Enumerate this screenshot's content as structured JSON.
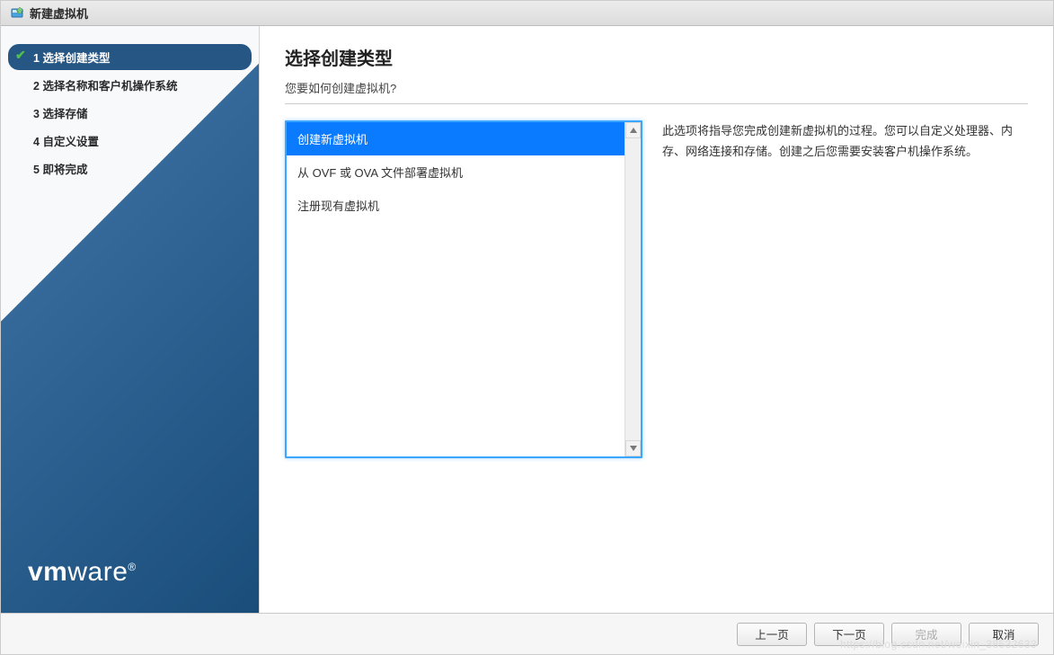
{
  "window": {
    "title": "新建虚拟机"
  },
  "sidebar": {
    "steps": [
      {
        "num": "1",
        "label": "选择创建类型",
        "active": true,
        "check": "✔"
      },
      {
        "num": "2",
        "label": "选择名称和客户机操作系统",
        "active": false
      },
      {
        "num": "3",
        "label": "选择存储",
        "active": false
      },
      {
        "num": "4",
        "label": "自定义设置",
        "active": false
      },
      {
        "num": "5",
        "label": "即将完成",
        "active": false
      }
    ]
  },
  "brand": {
    "vm": "vm",
    "ware": "ware",
    "reg": "®"
  },
  "main": {
    "heading": "选择创建类型",
    "question": "您要如何创建虚拟机?"
  },
  "options": [
    {
      "label": "创建新虚拟机",
      "selected": true
    },
    {
      "label": "从 OVF 或 OVA 文件部署虚拟机",
      "selected": false
    },
    {
      "label": "注册现有虚拟机",
      "selected": false
    }
  ],
  "description": "此选项将指导您完成创建新虚拟机的过程。您可以自定义处理器、内存、网络连接和存储。创建之后您需要安装客户机操作系统。",
  "footer": {
    "back": "上一页",
    "next": "下一页",
    "finish": "完成",
    "cancel": "取消"
  },
  "watermark": "https://blog.csdn.net/weixin_38532633"
}
